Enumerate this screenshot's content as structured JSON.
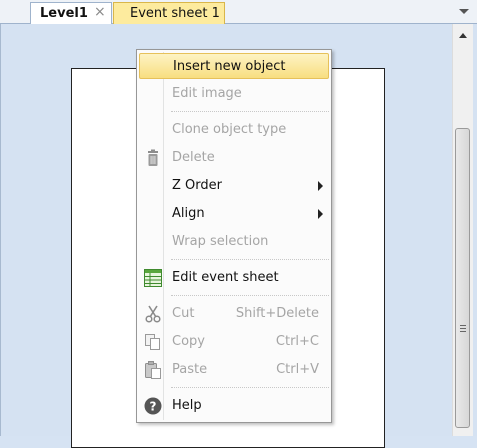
{
  "tabs": [
    {
      "label": "Level1",
      "close_glyph": "×",
      "active": true
    },
    {
      "label": "Event sheet 1"
    }
  ],
  "context_menu": {
    "items": [
      {
        "label": "Insert new object",
        "highlighted": true
      },
      {
        "label": "Edit image",
        "disabled": true
      },
      {
        "label": "Clone object type",
        "disabled": true
      },
      {
        "label": "Delete",
        "disabled": true,
        "icon": "trash-icon"
      },
      {
        "label": "Z Order",
        "submenu": true
      },
      {
        "label": "Align",
        "submenu": true
      },
      {
        "label": "Wrap selection",
        "disabled": true
      },
      {
        "label": "Edit event sheet",
        "icon": "event-sheet-icon"
      },
      {
        "label": "Cut",
        "shortcut": "Shift+Delete",
        "disabled": true,
        "icon": "scissors-icon"
      },
      {
        "label": "Copy",
        "shortcut": "Ctrl+C",
        "disabled": true,
        "icon": "copy-icon"
      },
      {
        "label": "Paste",
        "shortcut": "Ctrl+V",
        "disabled": true,
        "icon": "paste-icon"
      },
      {
        "label": "Help",
        "icon": "help-icon"
      }
    ]
  },
  "colors": {
    "workspace": "#d5e2f2",
    "event_tab": "#fdeb9e",
    "highlight": "#f8de80"
  }
}
